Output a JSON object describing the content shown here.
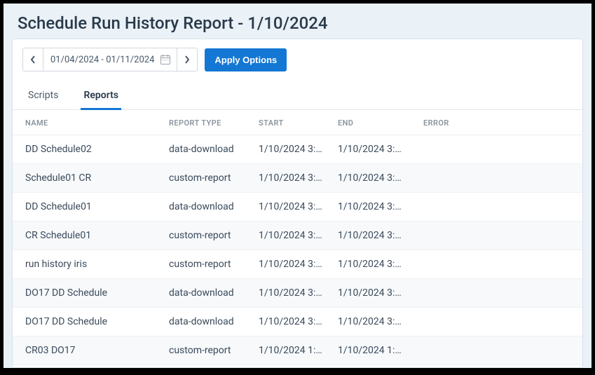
{
  "title": "Schedule Run History Report - 1/10/2024",
  "dateRange": "01/04/2024 - 01/11/2024",
  "applyLabel": "Apply Options",
  "tabs": {
    "scripts": "Scripts",
    "reports": "Reports",
    "active": "reports"
  },
  "columns": {
    "name": "NAME",
    "type": "REPORT TYPE",
    "start": "START",
    "end": "END",
    "error": "ERROR"
  },
  "rows": [
    {
      "name": "DD Schedule02",
      "type": "data-download",
      "start": "1/10/2024 3:…",
      "end": "1/10/2024 3:…",
      "error": ""
    },
    {
      "name": "Schedule01 CR",
      "type": "custom-report",
      "start": "1/10/2024 3:…",
      "end": "1/10/2024 3:…",
      "error": ""
    },
    {
      "name": "DD Schedule01",
      "type": "data-download",
      "start": "1/10/2024 3:…",
      "end": "1/10/2024 3:…",
      "error": ""
    },
    {
      "name": "CR Schedule01",
      "type": "custom-report",
      "start": "1/10/2024 3:…",
      "end": "1/10/2024 3:…",
      "error": ""
    },
    {
      "name": "run history iris",
      "type": "custom-report",
      "start": "1/10/2024 3:…",
      "end": "1/10/2024 3:…",
      "error": ""
    },
    {
      "name": "DO17 DD Schedule",
      "type": "data-download",
      "start": "1/10/2024 3:…",
      "end": "1/10/2024 3:…",
      "error": ""
    },
    {
      "name": "DO17 DD Schedule",
      "type": "data-download",
      "start": "1/10/2024 3:…",
      "end": "1/10/2024 3:…",
      "error": ""
    },
    {
      "name": "CR03 DO17",
      "type": "custom-report",
      "start": "1/10/2024 1:…",
      "end": "1/10/2024 1:…",
      "error": ""
    }
  ]
}
